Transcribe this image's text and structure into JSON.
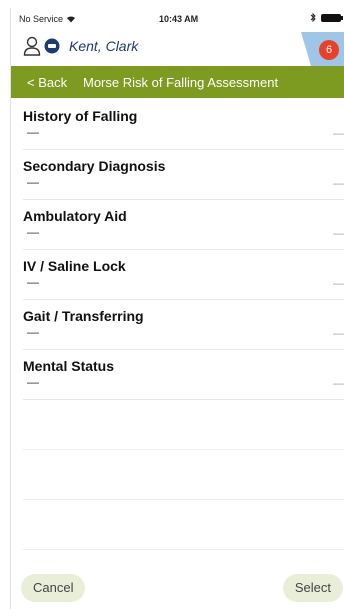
{
  "status_bar": {
    "carrier": "No Service",
    "time": "10:43 AM",
    "wifi_icon": "wifi-icon",
    "bluetooth_icon": "bluetooth-icon",
    "battery_icon": "battery-icon"
  },
  "patient": {
    "name": "Kent, Clark",
    "badge_count": "6"
  },
  "nav": {
    "back_label": "< Back",
    "title": "Morse Risk of Falling Assessment"
  },
  "items": [
    {
      "label": "History of Falling",
      "value": "—",
      "right": "—"
    },
    {
      "label": "Secondary Diagnosis",
      "value": "—",
      "right": "—"
    },
    {
      "label": "Ambulatory Aid",
      "value": "—",
      "right": "—"
    },
    {
      "label": "IV / Saline Lock",
      "value": "—",
      "right": "—"
    },
    {
      "label": "Gait / Transferring",
      "value": "—",
      "right": "—"
    },
    {
      "label": "Mental Status",
      "value": "—",
      "right": "—"
    }
  ],
  "footer": {
    "cancel_label": "Cancel",
    "select_label": "Select"
  },
  "colors": {
    "nav_bg": "#7d9a21",
    "badge_bg": "#e8412a",
    "patient_name": "#1d3b72"
  }
}
